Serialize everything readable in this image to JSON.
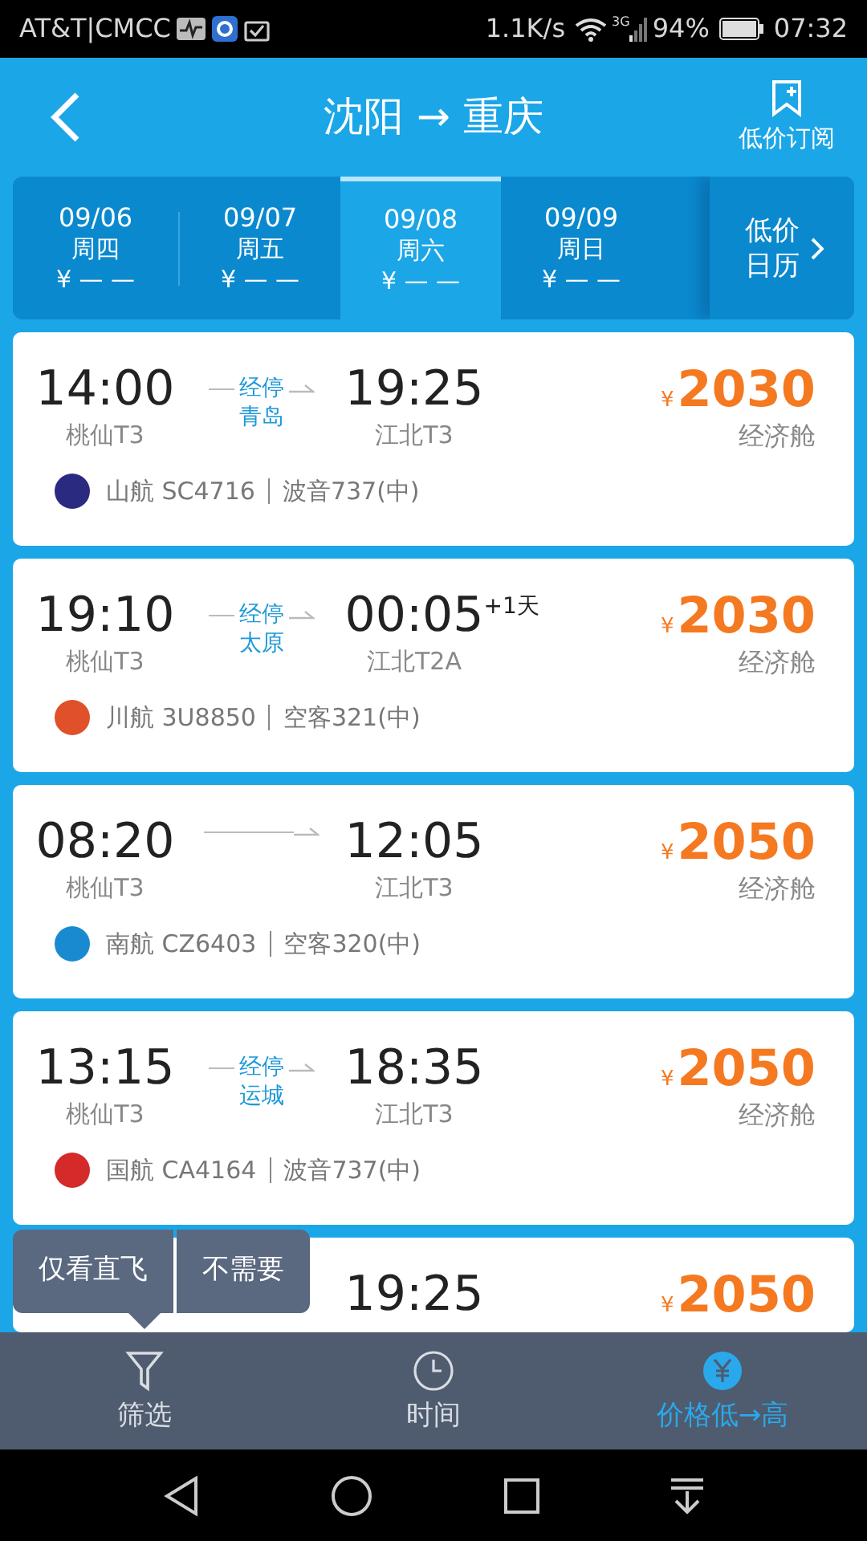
{
  "status_bar": {
    "carrier": "AT&T|CMCC",
    "speed": "1.1K/s",
    "network": "3G",
    "battery": "94%",
    "time": "07:32"
  },
  "header": {
    "title": "沈阳 → 重庆",
    "subscribe": "低价订阅"
  },
  "dates": [
    {
      "date": "09/06",
      "weekday": "周四",
      "price": "¥ — —",
      "selected": false
    },
    {
      "date": "09/07",
      "weekday": "周五",
      "price": "¥ — —",
      "selected": false
    },
    {
      "date": "09/08",
      "weekday": "周六",
      "price": "¥ — —",
      "selected": true
    },
    {
      "date": "09/09",
      "weekday": "周日",
      "price": "¥ — —",
      "selected": false
    }
  ],
  "calendar_button": "低价日历",
  "flights": [
    {
      "depart": "14:00",
      "depart_airport": "桃仙T3",
      "stop": "经停",
      "stop_city": "青岛",
      "arrive": "19:25",
      "arrive_airport": "江北T3",
      "currency": "¥",
      "price": "2030",
      "cabin": "经济舱",
      "airline": "山航 SC4716",
      "aircraft": "波音737(中)",
      "color": "#2a2a80"
    },
    {
      "depart": "19:10",
      "depart_airport": "桃仙T3",
      "stop": "经停",
      "stop_city": "太原",
      "arrive": "00:05",
      "next_day": "+1天",
      "arrive_airport": "江北T2A",
      "currency": "¥",
      "price": "2030",
      "cabin": "经济舱",
      "airline": "川航 3U8850",
      "aircraft": "空客321(中)",
      "color": "#e0502a"
    },
    {
      "depart": "08:20",
      "depart_airport": "桃仙T3",
      "arrive": "12:05",
      "arrive_airport": "江北T3",
      "currency": "¥",
      "price": "2050",
      "cabin": "经济舱",
      "airline": "南航 CZ6403",
      "aircraft": "空客320(中)",
      "color": "#1a8ad0"
    },
    {
      "depart": "13:15",
      "depart_airport": "桃仙T3",
      "stop": "经停",
      "stop_city": "运城",
      "arrive": "18:35",
      "arrive_airport": "江北T3",
      "currency": "¥",
      "price": "2050",
      "cabin": "经济舱",
      "airline": "国航 CA4164",
      "aircraft": "波音737(中)",
      "color": "#d42a2a"
    },
    {
      "arrive": "19:25",
      "currency": "¥",
      "price": "2050"
    }
  ],
  "popup": [
    "仅看直飞",
    "不需要"
  ],
  "bottom_tabs": [
    {
      "kind": "filter",
      "label": "筛选",
      "selected": false
    },
    {
      "kind": "clock",
      "label": "时间",
      "selected": false
    },
    {
      "kind": "price",
      "label": "价格低→高",
      "selected": true
    }
  ]
}
